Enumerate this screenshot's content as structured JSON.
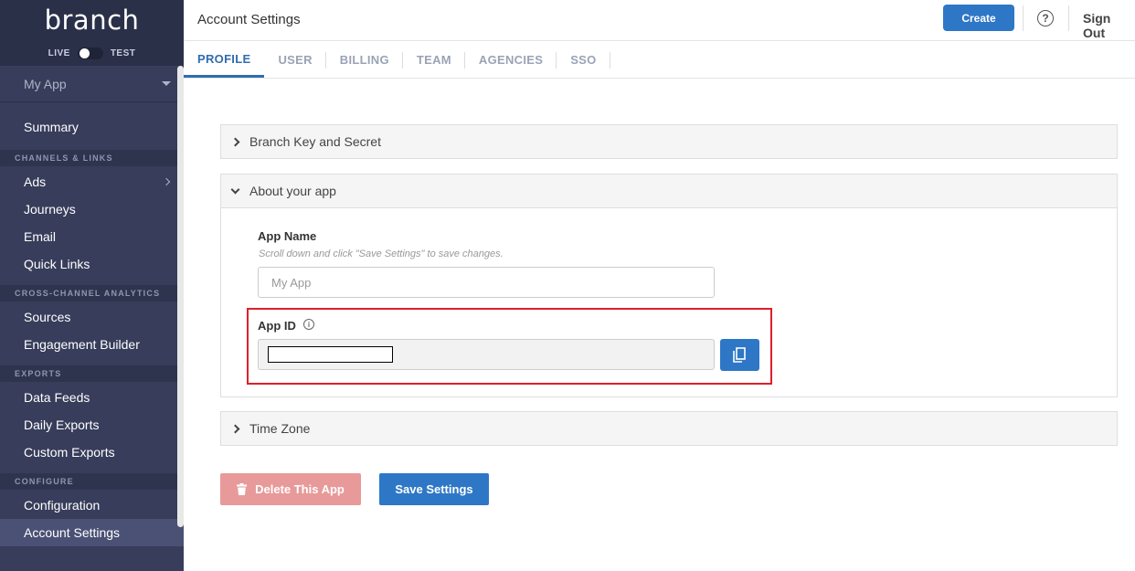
{
  "sidebar": {
    "logo": "branch",
    "toggle": {
      "live": "LIVE",
      "test": "TEST"
    },
    "app_selector": "My App",
    "summary": "Summary",
    "sections": {
      "channels": "CHANNELS & LINKS",
      "analytics": "CROSS-CHANNEL ANALYTICS",
      "exports": "EXPORTS",
      "configure": "CONFIGURE"
    },
    "items": {
      "ads": "Ads",
      "journeys": "Journeys",
      "email": "Email",
      "quick_links": "Quick Links",
      "sources": "Sources",
      "engagement_builder": "Engagement Builder",
      "data_feeds": "Data Feeds",
      "daily_exports": "Daily Exports",
      "custom_exports": "Custom Exports",
      "configuration": "Configuration",
      "account_settings": "Account Settings"
    }
  },
  "header": {
    "title": "Account Settings",
    "create": "Create",
    "help": "?",
    "sign_out": "Sign Out"
  },
  "tabs": [
    "PROFILE",
    "USER",
    "BILLING",
    "TEAM",
    "AGENCIES",
    "SSO"
  ],
  "panels": {
    "key_secret": "Branch Key and Secret",
    "about": "About your app",
    "time_zone": "Time Zone"
  },
  "form": {
    "app_name_label": "App Name",
    "app_name_help": "Scroll down and click \"Save Settings\" to save changes.",
    "app_name_value": "My App",
    "app_id_label": "App ID",
    "info_glyph": "i"
  },
  "actions": {
    "delete": "Delete This App",
    "save": "Save Settings"
  },
  "colors": {
    "sidebar": "#373d5a",
    "primary": "#2e77c6",
    "danger": "#e79a99",
    "highlight": "#dd1f2a"
  }
}
